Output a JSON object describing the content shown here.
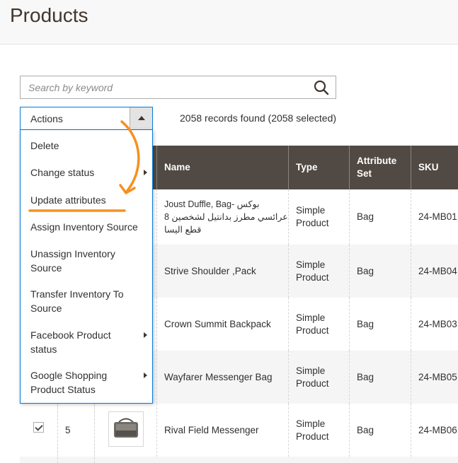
{
  "page": {
    "title": "Products"
  },
  "search": {
    "placeholder": "Search by keyword",
    "value": ""
  },
  "actions": {
    "label": "Actions"
  },
  "records": {
    "text": "2058 records found (2058 selected)"
  },
  "menu": {
    "items": [
      {
        "label": "Delete",
        "has_submenu": false
      },
      {
        "label": "Change status",
        "has_submenu": true
      },
      {
        "label": "Update attributes",
        "has_submenu": false
      },
      {
        "label": "Assign Inventory Source",
        "has_submenu": false
      },
      {
        "label": "Unassign Inventory Source",
        "has_submenu": false
      },
      {
        "label": "Transfer Inventory To Source",
        "has_submenu": false
      },
      {
        "label": "Facebook Product status",
        "has_submenu": true
      },
      {
        "label": "Google Shopping Product Status",
        "has_submenu": true
      }
    ]
  },
  "grid": {
    "columns": {
      "name": "Name",
      "type": "Type",
      "attribute_set": "Attribute Set",
      "sku": "SKU"
    },
    "rows": [
      {
        "name": "Joust Duffle, Bag- بوكس عرائسي مطرز  بدانتيل  لشخصين 8 قطع اليسا",
        "type": "Simple Product",
        "attribute_set": "Bag",
        "sku": "24-MB01"
      },
      {
        "name": "Strive Shoulder ,Pack",
        "type": "Simple Product",
        "attribute_set": "Bag",
        "sku": "24-MB04"
      },
      {
        "name": "Crown Summit Backpack",
        "type": "Simple Product",
        "attribute_set": "Bag",
        "sku": "24-MB03"
      },
      {
        "name": "Wayfarer Messenger Bag",
        "type": "Simple Product",
        "attribute_set": "Bag",
        "sku": "24-MB05"
      },
      {
        "id": "5",
        "checked": true,
        "name": "Rival Field Messenger",
        "type": "Simple Product",
        "attribute_set": "Bag",
        "sku": "24-MB06"
      }
    ]
  },
  "colors": {
    "accent": "#007bdb",
    "annotation": "#f7901e",
    "header_dark": "#514943"
  },
  "icons": {
    "search": "search-icon",
    "dropdown": "triangle-up-icon",
    "submenu": "chevron-right-icon"
  }
}
